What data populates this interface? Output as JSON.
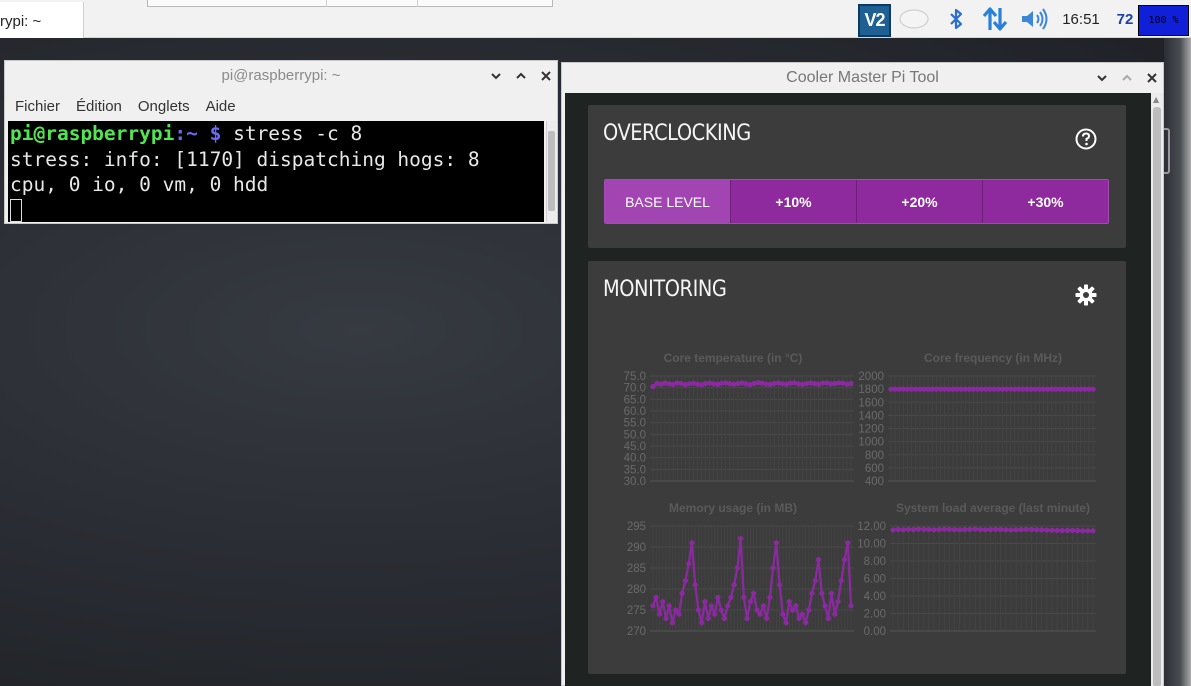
{
  "panel": {
    "taskbar_label": "rypi: ~",
    "clock": "16:51",
    "cpu_value": "72",
    "cpu_bar_text": "100 %",
    "tray_icons": [
      "vnc-icon",
      "ellipse-icon",
      "bluetooth-icon",
      "network-icon",
      "volume-icon"
    ]
  },
  "terminal": {
    "title": "pi@raspberrypi: ~",
    "menu": [
      "Fichier",
      "Édition",
      "Onglets",
      "Aide"
    ],
    "prompt_user": "pi@raspberrypi",
    "prompt_path": ":~ $",
    "command": " stress -c 8",
    "output_line_1": "stress: info: [1170] dispatching hogs: 8",
    "output_line_2": "cpu, 0 io, 0 vm, 0 hdd"
  },
  "cooler": {
    "title": "Cooler Master Pi Tool",
    "overclocking": {
      "title": "OVERCLOCKING",
      "buttons": [
        "BASE LEVEL",
        "+10%",
        "+20%",
        "+30%"
      ],
      "selected": "BASE LEVEL"
    },
    "monitoring": {
      "title": "MONITORING"
    },
    "colors": {
      "accent": "#8e2a9e",
      "line": "#8b2aa0",
      "card": "#3c3c3c",
      "background": "#1f2322"
    }
  },
  "chart_data": [
    {
      "type": "line",
      "title": "Core temperature (in °C)",
      "ylim": [
        30,
        75
      ],
      "yticks": [
        "75.0",
        "70.0",
        "65.0",
        "60.0",
        "55.0",
        "50.0",
        "45.0",
        "40.0",
        "35.0",
        "30.0"
      ],
      "series": [
        {
          "values": [
            70.5,
            71.8,
            71.5,
            72.0,
            71.6,
            71.4,
            72.0,
            71.8,
            71.3,
            71.7,
            71.9,
            71.5,
            71.2,
            71.8,
            72.0,
            71.6,
            71.4,
            71.9,
            72.1,
            71.7,
            71.5,
            71.8,
            72.0,
            71.6,
            71.3,
            71.8,
            72.2,
            71.9,
            71.5,
            71.4,
            71.8,
            72.0,
            71.7,
            71.5,
            71.9,
            72.1,
            71.6,
            71.4,
            71.8,
            72.0,
            71.7,
            71.5,
            71.9,
            72.0,
            71.6,
            71.8,
            72.1,
            71.9,
            71.5,
            71.8
          ]
        }
      ]
    },
    {
      "type": "line",
      "title": "Core frequency (in MHz)",
      "ylim": [
        400,
        2000
      ],
      "yticks": [
        "2000",
        "1800",
        "1600",
        "1400",
        "1200",
        "1000",
        "800",
        "600",
        "400"
      ],
      "series": [
        {
          "values": [
            1800,
            1800,
            1800,
            1800,
            1800,
            1800,
            1800,
            1800,
            1800,
            1800,
            1800,
            1800,
            1800,
            1800,
            1800,
            1800,
            1800,
            1800,
            1800,
            1800,
            1800,
            1800,
            1800,
            1800,
            1800,
            1800,
            1800,
            1800,
            1800,
            1800,
            1800,
            1800,
            1800,
            1800,
            1800,
            1800,
            1800,
            1800,
            1800,
            1800,
            1800,
            1800,
            1800,
            1800,
            1800,
            1800,
            1800,
            1800,
            1800,
            1800
          ]
        }
      ]
    },
    {
      "type": "line",
      "title": "Memory usage (in MB)",
      "ylim": [
        270,
        295
      ],
      "yticks": [
        "295",
        "290",
        "285",
        "280",
        "275",
        "270"
      ],
      "series": [
        {
          "values": [
            276,
            278,
            274,
            277,
            273,
            276,
            272,
            275,
            274,
            279,
            282,
            286,
            291,
            281,
            275,
            272,
            277,
            273,
            276,
            274,
            278,
            275,
            273,
            276,
            278,
            281,
            285,
            292,
            278,
            273,
            277,
            279,
            275,
            274,
            276,
            273,
            278,
            285,
            291,
            281,
            274,
            272,
            277,
            275,
            276,
            273,
            274,
            272,
            275,
            279,
            282,
            287,
            279,
            276,
            273,
            279,
            274,
            277,
            282,
            287,
            291,
            276
          ]
        }
      ]
    },
    {
      "type": "line",
      "title": "System load average (last minute)",
      "ylim": [
        0,
        12
      ],
      "yticks": [
        "12.00",
        "10.00",
        "8.00",
        "6.00",
        "4.00",
        "2.00",
        "0.00"
      ],
      "series": [
        {
          "values": [
            11.55,
            11.6,
            11.58,
            11.62,
            11.6,
            11.64,
            11.62,
            11.6,
            11.58,
            11.6,
            11.63,
            11.62,
            11.6,
            11.58,
            11.6,
            11.62,
            11.64,
            11.6,
            11.58,
            11.6,
            11.62,
            11.6,
            11.58,
            11.56,
            11.58,
            11.6,
            11.62,
            11.6,
            11.58,
            11.56,
            11.54,
            11.52,
            11.5,
            11.48,
            11.5,
            11.5,
            11.48,
            11.46,
            11.45,
            11.45
          ]
        }
      ]
    }
  ]
}
